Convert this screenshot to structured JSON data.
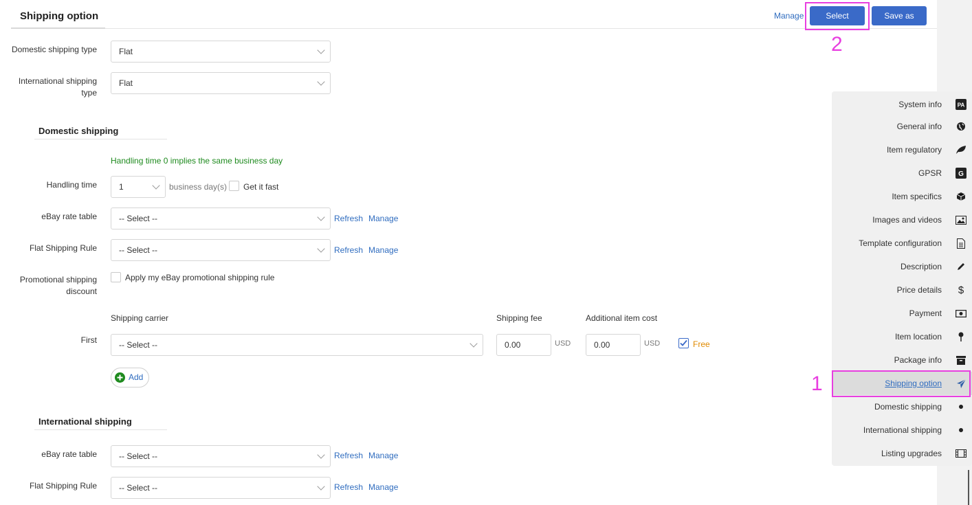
{
  "header": {
    "title": "Shipping option",
    "manage_label": "Manage",
    "select_label": "Select",
    "save_as_label": "Save as"
  },
  "markers": {
    "one": "1",
    "two": "2"
  },
  "shipping_types": {
    "domestic_label": "Domestic shipping type",
    "domestic_value": "Flat",
    "international_label_line1": "International shipping",
    "international_label_line2": "type",
    "international_value": "Flat"
  },
  "domestic": {
    "title": "Domestic shipping",
    "hint": "Handling time 0 implies the same business day",
    "handling_label": "Handling time",
    "handling_value": "1",
    "business_days": "business day(s)",
    "get_it_fast": "Get it fast",
    "rate_table_label": "eBay rate table",
    "rate_table_value": "-- Select --",
    "flat_rule_label": "Flat Shipping Rule",
    "flat_rule_value": "-- Select --",
    "refresh": "Refresh",
    "manage": "Manage",
    "promo_label_line1": "Promotional shipping",
    "promo_label_line2": "discount",
    "promo_text": "Apply my eBay promotional shipping rule",
    "col_carrier": "Shipping carrier",
    "col_fee": "Shipping fee",
    "col_additional": "Additional item cost",
    "first_label": "First",
    "carrier_value": "-- Select --",
    "fee_value": "0.00",
    "fee_currency": "USD",
    "additional_value": "0.00",
    "additional_currency": "USD",
    "free_label": "Free",
    "add_label": "Add"
  },
  "international": {
    "title": "International shipping",
    "rate_table_label": "eBay rate table",
    "rate_table_value": "-- Select --",
    "flat_rule_label": "Flat Shipping Rule",
    "flat_rule_value": "-- Select --",
    "refresh": "Refresh",
    "manage": "Manage"
  },
  "nav": {
    "items": [
      {
        "label": "System info",
        "icon": "pa-badge-icon"
      },
      {
        "label": "General info",
        "icon": "globe-icon"
      },
      {
        "label": "Item regulatory",
        "icon": "leaf-icon"
      },
      {
        "label": "GPSR",
        "icon": "g-badge-icon"
      },
      {
        "label": "Item specifics",
        "icon": "cube-icon"
      },
      {
        "label": "Images and videos",
        "icon": "image-icon"
      },
      {
        "label": "Template configuration",
        "icon": "document-icon"
      },
      {
        "label": "Description",
        "icon": "pencil-icon"
      },
      {
        "label": "Price details",
        "icon": "dollar-icon"
      },
      {
        "label": "Payment",
        "icon": "money-icon"
      },
      {
        "label": "Item location",
        "icon": "pin-icon"
      },
      {
        "label": "Package info",
        "icon": "archive-icon"
      },
      {
        "label": "Shipping option",
        "icon": "plane-icon",
        "active": true
      },
      {
        "label": "Domestic shipping",
        "icon": "dot-icon"
      },
      {
        "label": "International shipping",
        "icon": "dot-icon"
      },
      {
        "label": "Listing upgrades",
        "icon": "film-icon"
      }
    ]
  },
  "colors": {
    "accent": "#3a6ac8",
    "link": "#2f6cbf",
    "highlight": "#e83ee0",
    "hint_green": "#1e8a1e",
    "free_orange": "#e08a00"
  }
}
